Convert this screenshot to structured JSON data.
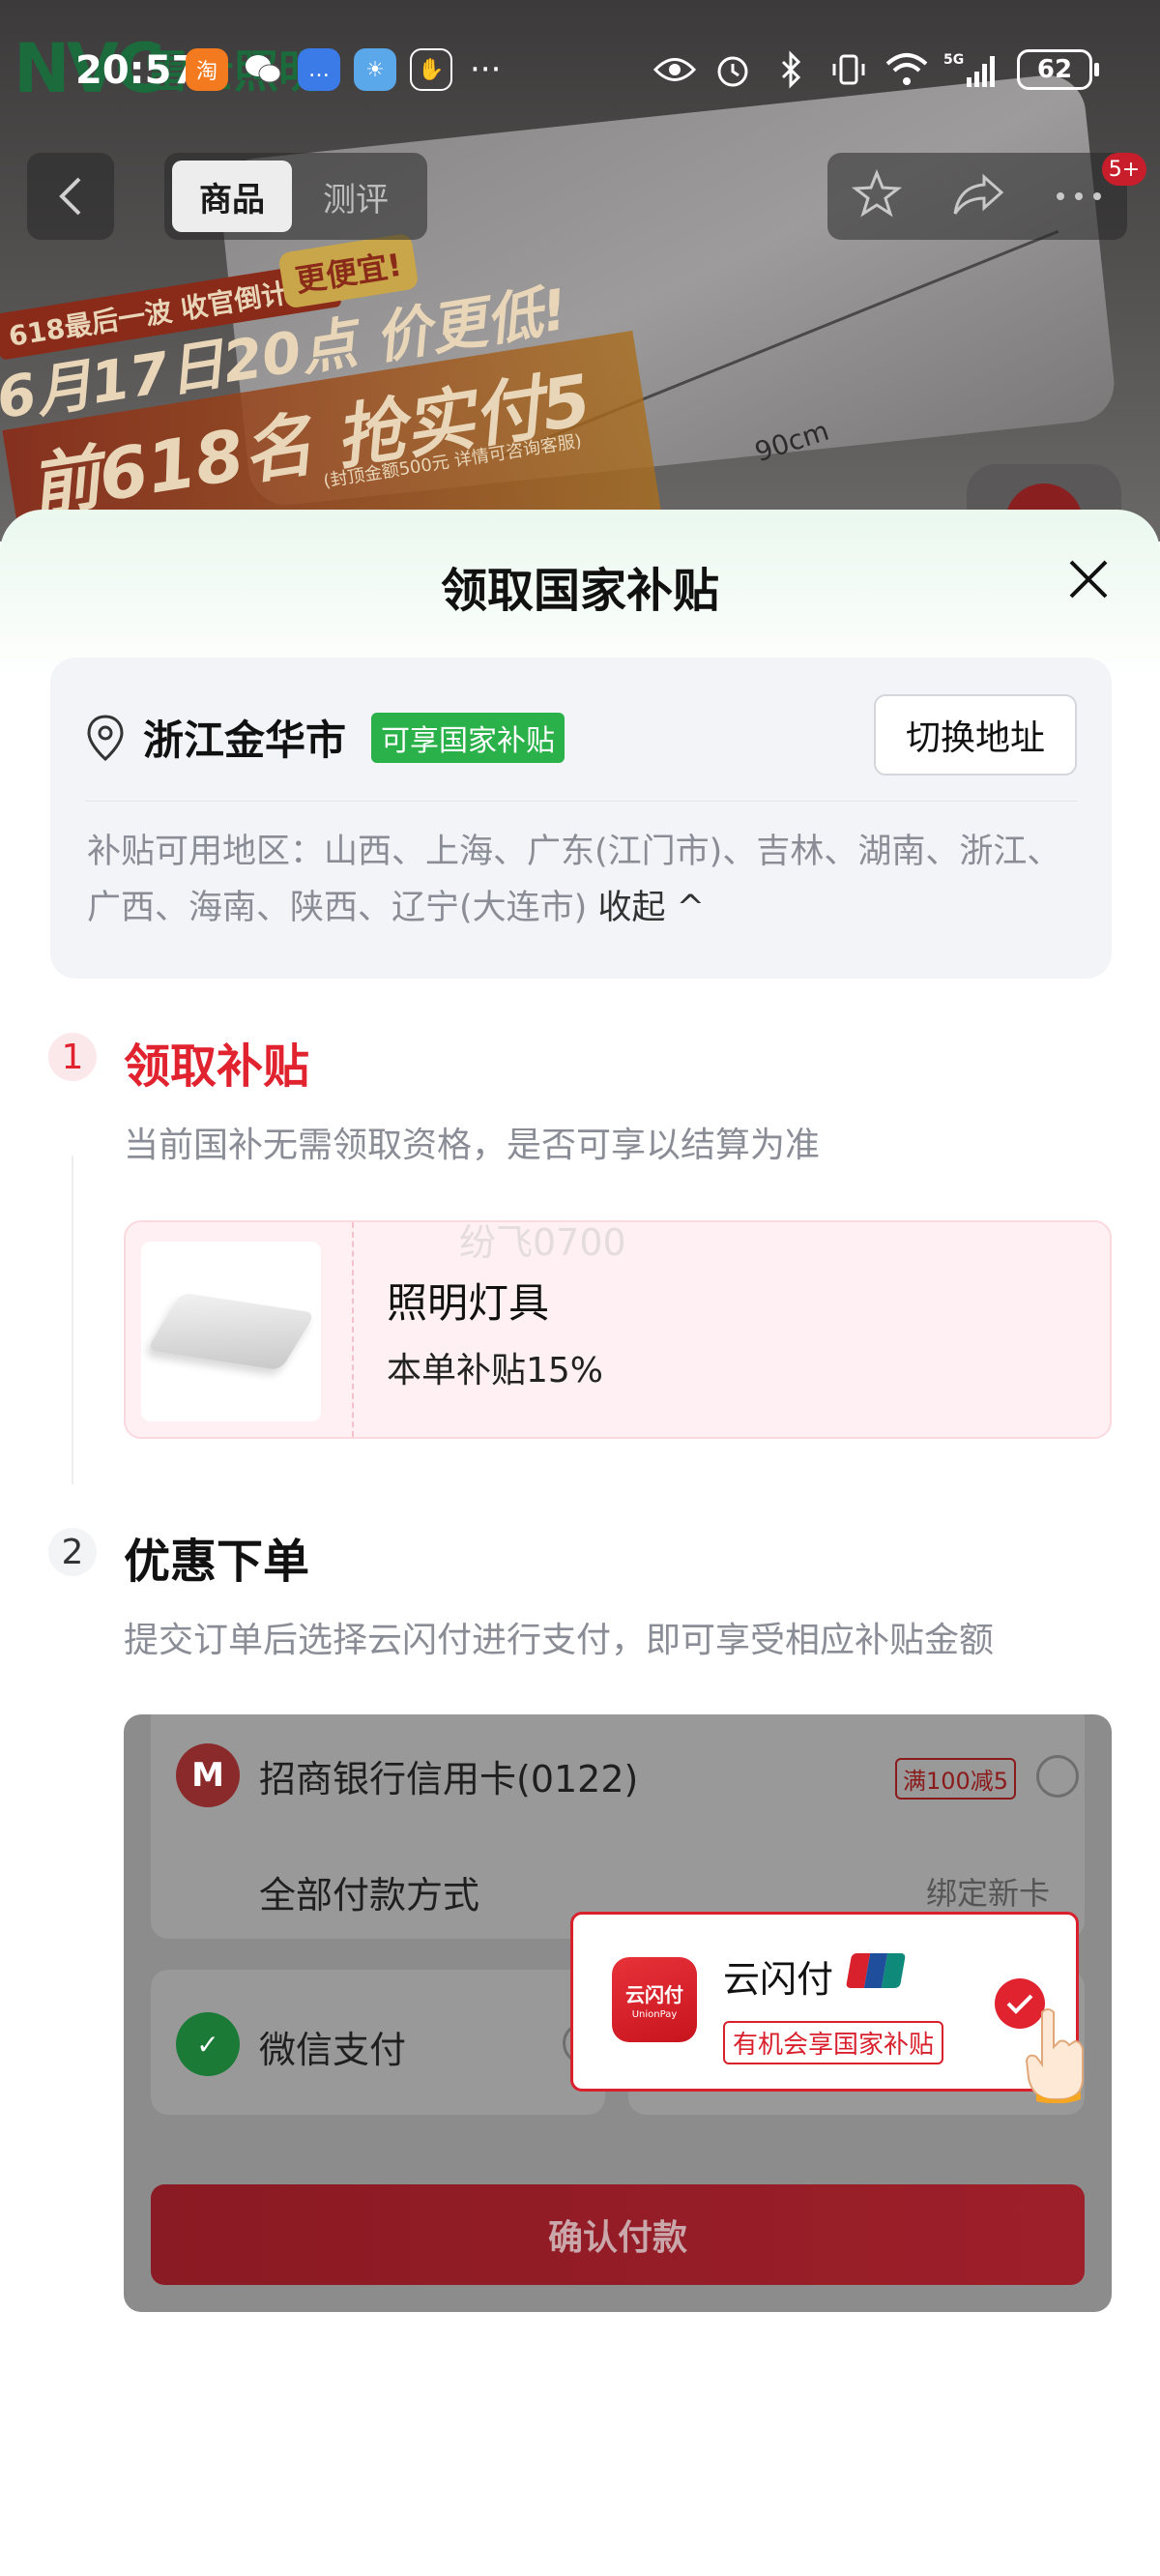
{
  "status_bar": {
    "time": "20:57",
    "battery": "62",
    "network": "5G"
  },
  "background": {
    "brand_logo": "NVC",
    "brand_cn": "雷士照明",
    "dimension_label": "90cm",
    "banner": {
      "line1": "618最后一波 收官倒计时!",
      "line2": "更便宜!",
      "line3": "6月17日20点 价更低!",
      "line4": "前618名 抢实付5折",
      "note": "(封顶金额500元 详情可咨询客服)"
    }
  },
  "nav": {
    "tabs": [
      "商品",
      "测评"
    ],
    "badge": "5+"
  },
  "sheet": {
    "title": "领取国家补贴",
    "address": {
      "city": "浙江金华市",
      "tag": "可享国家补贴",
      "switch_label": "切换地址",
      "area_prefix": "补贴可用地区：",
      "area_list": "山西、上海、广东(江门市)、吉林、湖南、浙江、广西、海南、陕西、辽宁(大连市)",
      "collapse_label": "收起 ^"
    },
    "step1": {
      "number": "1",
      "title": "领取补贴",
      "desc": "当前国补无需领取资格，是否可享以结算为准",
      "product_name": "照明灯具",
      "product_subsidy": "本单补贴15%",
      "watermark": "纷飞0700"
    },
    "step2": {
      "number": "2",
      "title": "优惠下单",
      "desc": "提交订单后选择云闪付进行支付，即可享受相应补贴金额"
    },
    "payment": {
      "bank_name": "招商银行信用卡(0122)",
      "bank_promo": "满100减5",
      "all_methods": "全部付款方式",
      "bind_card": "绑定新卡 >",
      "wechat": "微信支付",
      "confirm": "确认付款",
      "unionpay_name": "云闪付",
      "unionpay_promo": "有机会享国家补贴",
      "unionpay_logo_text": "云闪付",
      "unionpay_logo_sub": "UnionPay"
    }
  },
  "colors": {
    "accent_red": "#e0232f",
    "subsidy_green": "#2bb14a"
  }
}
